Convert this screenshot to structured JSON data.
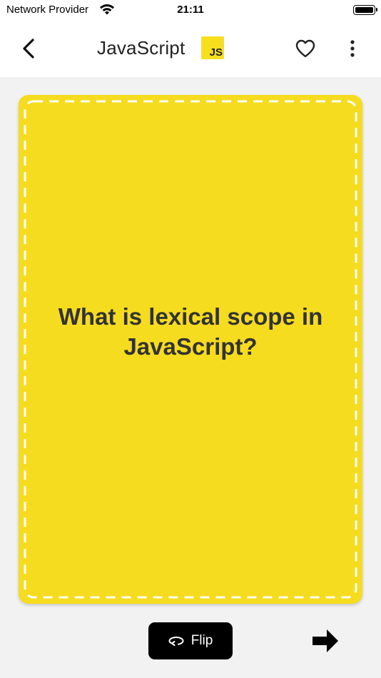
{
  "status_bar": {
    "carrier": "Network Provider",
    "time": "21:11",
    "icons": [
      "wifi-icon",
      "battery-icon"
    ]
  },
  "nav": {
    "title": "JavaScript",
    "logo_text": "JS",
    "icons": [
      "chevron-left-icon",
      "heart-outline-icon",
      "more-vertical-icon"
    ]
  },
  "card": {
    "question": "What is lexical scope in JavaScript?"
  },
  "controls": {
    "flip_label": "Flip",
    "icons": [
      "flip-rotate-icon",
      "arrow-right-icon"
    ]
  },
  "colors": {
    "card": "#f6dc1e",
    "js_logo": "#f7df1e",
    "background": "#f2f2f2",
    "button": "#000000"
  }
}
